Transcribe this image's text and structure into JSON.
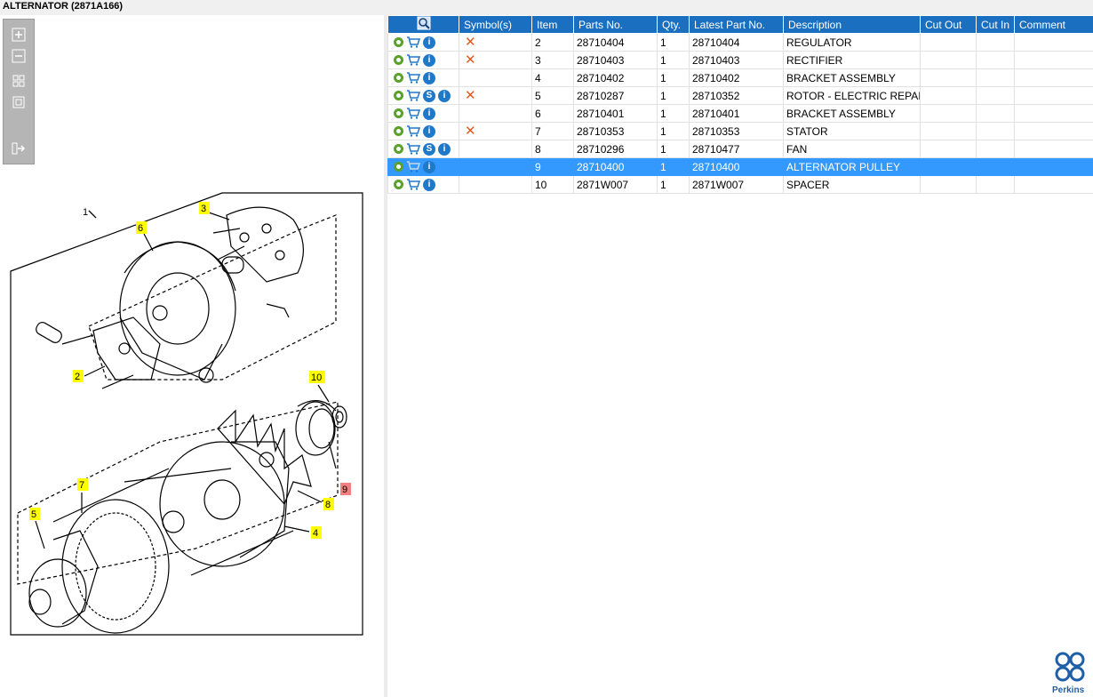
{
  "window": {
    "title": "ALTERNATOR (2871A166)"
  },
  "toolbar": {
    "buttons": [
      {
        "icon": "zoom-in-icon"
      },
      {
        "icon": "zoom-out-icon"
      },
      {
        "icon": "fit-view-icon"
      },
      {
        "icon": "actual-size-icon"
      },
      {
        "icon": "export-icon"
      }
    ]
  },
  "drawing": {
    "callouts": [
      "1",
      "2",
      "3",
      "4",
      "5",
      "6",
      "7",
      "8",
      "9",
      "10"
    ],
    "highlight_color": "#ffff00",
    "selected_color": "#f28080"
  },
  "table": {
    "columns": [
      "Symbol(s)",
      "Item",
      "Parts No.",
      "Qty.",
      "Latest Part No.",
      "Description",
      "Cut Out",
      "Cut In",
      "Comment"
    ],
    "rows": [
      {
        "item": "2",
        "part": "28710404",
        "qty": "1",
        "latest": "28710404",
        "desc": "REGULATOR",
        "supersede": false,
        "removed": true,
        "selected": false
      },
      {
        "item": "3",
        "part": "28710403",
        "qty": "1",
        "latest": "28710403",
        "desc": "RECTIFIER",
        "supersede": false,
        "removed": true,
        "selected": false
      },
      {
        "item": "4",
        "part": "28710402",
        "qty": "1",
        "latest": "28710402",
        "desc": "BRACKET ASSEMBLY",
        "supersede": false,
        "removed": false,
        "selected": false
      },
      {
        "item": "5",
        "part": "28710287",
        "qty": "1",
        "latest": "28710352",
        "desc": "ROTOR - ELECTRIC REPAIR",
        "supersede": true,
        "removed": true,
        "selected": false
      },
      {
        "item": "6",
        "part": "28710401",
        "qty": "1",
        "latest": "28710401",
        "desc": "BRACKET ASSEMBLY",
        "supersede": false,
        "removed": false,
        "selected": false
      },
      {
        "item": "7",
        "part": "28710353",
        "qty": "1",
        "latest": "28710353",
        "desc": "STATOR",
        "supersede": false,
        "removed": true,
        "selected": false
      },
      {
        "item": "8",
        "part": "28710296",
        "qty": "1",
        "latest": "28710477",
        "desc": "FAN",
        "supersede": true,
        "removed": false,
        "selected": false
      },
      {
        "item": "9",
        "part": "28710400",
        "qty": "1",
        "latest": "28710400",
        "desc": "ALTERNATOR PULLEY",
        "supersede": false,
        "removed": false,
        "selected": true
      },
      {
        "item": "10",
        "part": "2871W007",
        "qty": "1",
        "latest": "2871W007",
        "desc": "SPACER",
        "supersede": false,
        "removed": false,
        "selected": false
      }
    ],
    "supersede_symbol": "S",
    "info_symbol": "i"
  },
  "brand": {
    "name": "Perkins",
    "color": "#1f5fa8"
  },
  "colors": {
    "header": "#1a6fc0",
    "selected_row": "#3399ff",
    "remove_mark": "#e05a1e",
    "gear": "#5aa02c"
  }
}
